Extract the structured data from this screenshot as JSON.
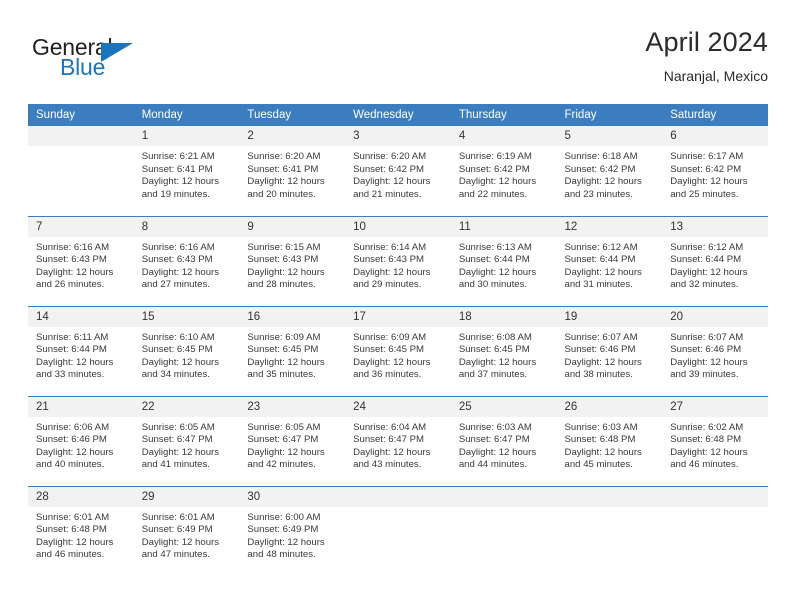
{
  "brand": {
    "name_part1": "General",
    "name_part2": "Blue",
    "triangle_icon": "triangle-icon",
    "accent_color": "#1b75bc"
  },
  "header": {
    "title": "April 2024",
    "location": "Naranjal, Mexico"
  },
  "colors": {
    "header_bar": "#3b7dbf",
    "daynum_band": "#f2f2f2",
    "text": "#3a3a3a"
  },
  "weekday_headers": [
    "Sunday",
    "Monday",
    "Tuesday",
    "Wednesday",
    "Thursday",
    "Friday",
    "Saturday"
  ],
  "weeks": [
    [
      {
        "day": "",
        "sunrise": "",
        "sunset": "",
        "daylight1": "",
        "daylight2": "",
        "empty": true
      },
      {
        "day": "1",
        "sunrise": "Sunrise: 6:21 AM",
        "sunset": "Sunset: 6:41 PM",
        "daylight1": "Daylight: 12 hours",
        "daylight2": "and 19 minutes."
      },
      {
        "day": "2",
        "sunrise": "Sunrise: 6:20 AM",
        "sunset": "Sunset: 6:41 PM",
        "daylight1": "Daylight: 12 hours",
        "daylight2": "and 20 minutes."
      },
      {
        "day": "3",
        "sunrise": "Sunrise: 6:20 AM",
        "sunset": "Sunset: 6:42 PM",
        "daylight1": "Daylight: 12 hours",
        "daylight2": "and 21 minutes."
      },
      {
        "day": "4",
        "sunrise": "Sunrise: 6:19 AM",
        "sunset": "Sunset: 6:42 PM",
        "daylight1": "Daylight: 12 hours",
        "daylight2": "and 22 minutes."
      },
      {
        "day": "5",
        "sunrise": "Sunrise: 6:18 AM",
        "sunset": "Sunset: 6:42 PM",
        "daylight1": "Daylight: 12 hours",
        "daylight2": "and 23 minutes."
      },
      {
        "day": "6",
        "sunrise": "Sunrise: 6:17 AM",
        "sunset": "Sunset: 6:42 PM",
        "daylight1": "Daylight: 12 hours",
        "daylight2": "and 25 minutes."
      }
    ],
    [
      {
        "day": "7",
        "sunrise": "Sunrise: 6:16 AM",
        "sunset": "Sunset: 6:43 PM",
        "daylight1": "Daylight: 12 hours",
        "daylight2": "and 26 minutes."
      },
      {
        "day": "8",
        "sunrise": "Sunrise: 6:16 AM",
        "sunset": "Sunset: 6:43 PM",
        "daylight1": "Daylight: 12 hours",
        "daylight2": "and 27 minutes."
      },
      {
        "day": "9",
        "sunrise": "Sunrise: 6:15 AM",
        "sunset": "Sunset: 6:43 PM",
        "daylight1": "Daylight: 12 hours",
        "daylight2": "and 28 minutes."
      },
      {
        "day": "10",
        "sunrise": "Sunrise: 6:14 AM",
        "sunset": "Sunset: 6:43 PM",
        "daylight1": "Daylight: 12 hours",
        "daylight2": "and 29 minutes."
      },
      {
        "day": "11",
        "sunrise": "Sunrise: 6:13 AM",
        "sunset": "Sunset: 6:44 PM",
        "daylight1": "Daylight: 12 hours",
        "daylight2": "and 30 minutes."
      },
      {
        "day": "12",
        "sunrise": "Sunrise: 6:12 AM",
        "sunset": "Sunset: 6:44 PM",
        "daylight1": "Daylight: 12 hours",
        "daylight2": "and 31 minutes."
      },
      {
        "day": "13",
        "sunrise": "Sunrise: 6:12 AM",
        "sunset": "Sunset: 6:44 PM",
        "daylight1": "Daylight: 12 hours",
        "daylight2": "and 32 minutes."
      }
    ],
    [
      {
        "day": "14",
        "sunrise": "Sunrise: 6:11 AM",
        "sunset": "Sunset: 6:44 PM",
        "daylight1": "Daylight: 12 hours",
        "daylight2": "and 33 minutes."
      },
      {
        "day": "15",
        "sunrise": "Sunrise: 6:10 AM",
        "sunset": "Sunset: 6:45 PM",
        "daylight1": "Daylight: 12 hours",
        "daylight2": "and 34 minutes."
      },
      {
        "day": "16",
        "sunrise": "Sunrise: 6:09 AM",
        "sunset": "Sunset: 6:45 PM",
        "daylight1": "Daylight: 12 hours",
        "daylight2": "and 35 minutes."
      },
      {
        "day": "17",
        "sunrise": "Sunrise: 6:09 AM",
        "sunset": "Sunset: 6:45 PM",
        "daylight1": "Daylight: 12 hours",
        "daylight2": "and 36 minutes."
      },
      {
        "day": "18",
        "sunrise": "Sunrise: 6:08 AM",
        "sunset": "Sunset: 6:45 PM",
        "daylight1": "Daylight: 12 hours",
        "daylight2": "and 37 minutes."
      },
      {
        "day": "19",
        "sunrise": "Sunrise: 6:07 AM",
        "sunset": "Sunset: 6:46 PM",
        "daylight1": "Daylight: 12 hours",
        "daylight2": "and 38 minutes."
      },
      {
        "day": "20",
        "sunrise": "Sunrise: 6:07 AM",
        "sunset": "Sunset: 6:46 PM",
        "daylight1": "Daylight: 12 hours",
        "daylight2": "and 39 minutes."
      }
    ],
    [
      {
        "day": "21",
        "sunrise": "Sunrise: 6:06 AM",
        "sunset": "Sunset: 6:46 PM",
        "daylight1": "Daylight: 12 hours",
        "daylight2": "and 40 minutes."
      },
      {
        "day": "22",
        "sunrise": "Sunrise: 6:05 AM",
        "sunset": "Sunset: 6:47 PM",
        "daylight1": "Daylight: 12 hours",
        "daylight2": "and 41 minutes."
      },
      {
        "day": "23",
        "sunrise": "Sunrise: 6:05 AM",
        "sunset": "Sunset: 6:47 PM",
        "daylight1": "Daylight: 12 hours",
        "daylight2": "and 42 minutes."
      },
      {
        "day": "24",
        "sunrise": "Sunrise: 6:04 AM",
        "sunset": "Sunset: 6:47 PM",
        "daylight1": "Daylight: 12 hours",
        "daylight2": "and 43 minutes."
      },
      {
        "day": "25",
        "sunrise": "Sunrise: 6:03 AM",
        "sunset": "Sunset: 6:47 PM",
        "daylight1": "Daylight: 12 hours",
        "daylight2": "and 44 minutes."
      },
      {
        "day": "26",
        "sunrise": "Sunrise: 6:03 AM",
        "sunset": "Sunset: 6:48 PM",
        "daylight1": "Daylight: 12 hours",
        "daylight2": "and 45 minutes."
      },
      {
        "day": "27",
        "sunrise": "Sunrise: 6:02 AM",
        "sunset": "Sunset: 6:48 PM",
        "daylight1": "Daylight: 12 hours",
        "daylight2": "and 46 minutes."
      }
    ],
    [
      {
        "day": "28",
        "sunrise": "Sunrise: 6:01 AM",
        "sunset": "Sunset: 6:48 PM",
        "daylight1": "Daylight: 12 hours",
        "daylight2": "and 46 minutes."
      },
      {
        "day": "29",
        "sunrise": "Sunrise: 6:01 AM",
        "sunset": "Sunset: 6:49 PM",
        "daylight1": "Daylight: 12 hours",
        "daylight2": "and 47 minutes."
      },
      {
        "day": "30",
        "sunrise": "Sunrise: 6:00 AM",
        "sunset": "Sunset: 6:49 PM",
        "daylight1": "Daylight: 12 hours",
        "daylight2": "and 48 minutes."
      },
      {
        "day": "",
        "sunrise": "",
        "sunset": "",
        "daylight1": "",
        "daylight2": "",
        "empty": true
      },
      {
        "day": "",
        "sunrise": "",
        "sunset": "",
        "daylight1": "",
        "daylight2": "",
        "empty": true
      },
      {
        "day": "",
        "sunrise": "",
        "sunset": "",
        "daylight1": "",
        "daylight2": "",
        "empty": true
      },
      {
        "day": "",
        "sunrise": "",
        "sunset": "",
        "daylight1": "",
        "daylight2": "",
        "empty": true
      }
    ]
  ]
}
